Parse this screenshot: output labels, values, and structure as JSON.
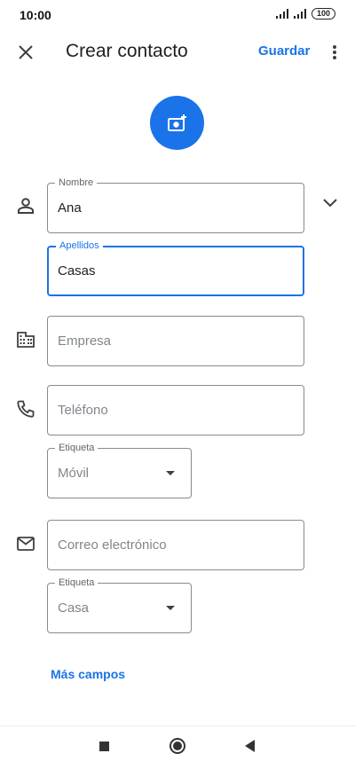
{
  "status_bar": {
    "time": "10:00",
    "battery": "100"
  },
  "app_bar": {
    "title": "Crear contacto",
    "save_label": "Guardar"
  },
  "form": {
    "first_name": {
      "label": "Nombre",
      "value": "Ana"
    },
    "last_name": {
      "label": "Apellidos",
      "value": "Casas"
    },
    "company": {
      "placeholder": "Empresa"
    },
    "phone": {
      "placeholder": "Teléfono"
    },
    "phone_label": {
      "label": "Etiqueta",
      "value": "Móvil"
    },
    "email": {
      "placeholder": "Correo electrónico"
    },
    "email_label": {
      "label": "Etiqueta",
      "value": "Casa"
    }
  },
  "more_fields_label": "Más campos",
  "colors": {
    "accent": "#1a73e8",
    "text": "#202124",
    "hint": "#80868b"
  }
}
